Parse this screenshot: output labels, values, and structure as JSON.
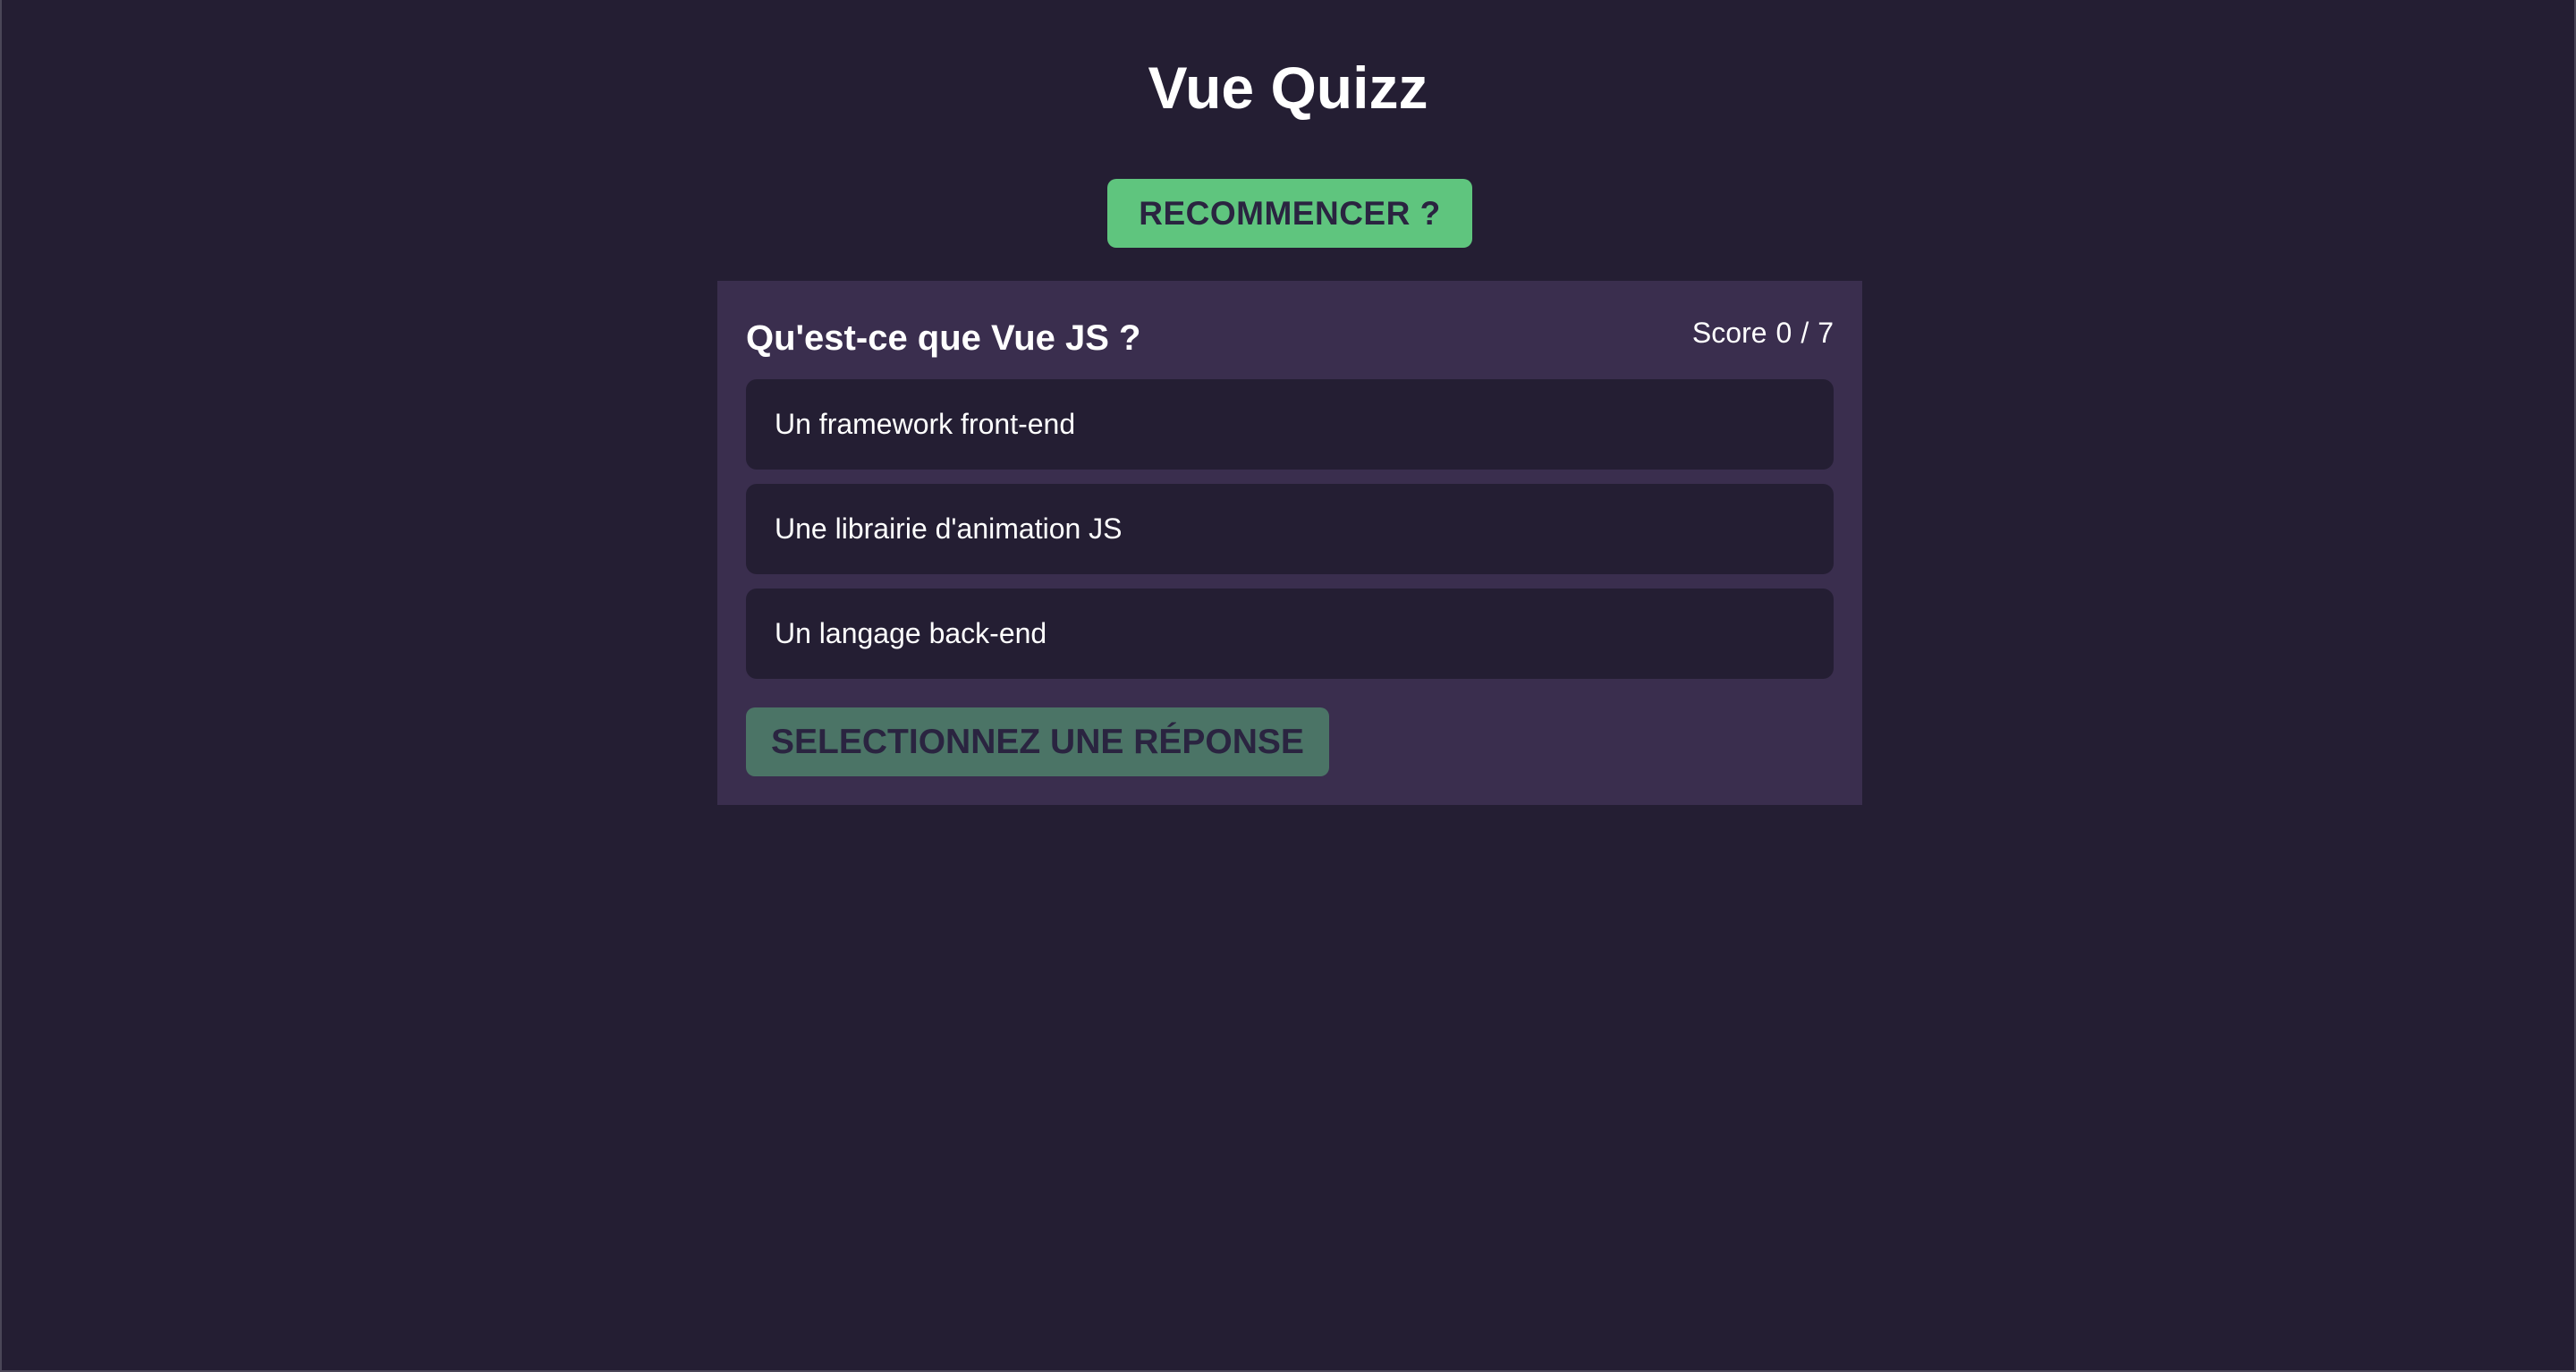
{
  "app": {
    "title": "Vue Quizz",
    "restart_label": "RECOMMENCER ?"
  },
  "quiz": {
    "question": "Qu'est-ce que Vue JS ?",
    "score_label": "Score",
    "score_current": "0",
    "score_separator": "/",
    "score_total": "7",
    "answers": [
      {
        "label": "Un framework front-end"
      },
      {
        "label": "Une librairie d'animation JS"
      },
      {
        "label": "Un langage back-end"
      }
    ],
    "submit_label": "SELECTIONNEZ UNE RÉPONSE",
    "submit_disabled": true
  },
  "colors": {
    "background": "#241e33",
    "card": "#3a2e4e",
    "accent": "#5fc57e",
    "accent_disabled": "#4b7466"
  }
}
